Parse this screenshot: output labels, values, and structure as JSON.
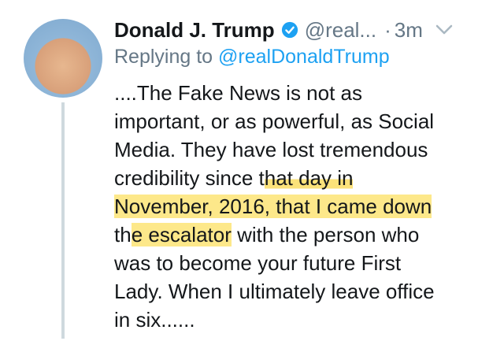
{
  "tweet": {
    "author_name": "Donald J. Trump",
    "author_handle": "@real...",
    "separator": "·",
    "time": "3m",
    "reply_prefix": "Replying to ",
    "reply_mention": "@realDonaldTrump",
    "body_lines": [
      "....The Fake News is not as",
      "important, or as powerful, as Social",
      "Media. They have lost tremendous",
      "credibility since t",
      "hat day in",
      "November, 2016, that I came down",
      "th",
      "e escalator",
      " with the person who",
      "was to become your future First",
      "Lady. When I ultimately leave office",
      "in six......"
    ]
  },
  "icons": {
    "verified": "verified-badge-icon",
    "chevron": "chevron-down-icon"
  },
  "colors": {
    "verified_blue": "#1da1f2",
    "secondary_text": "#657786",
    "highlight": "#fbe27a"
  }
}
